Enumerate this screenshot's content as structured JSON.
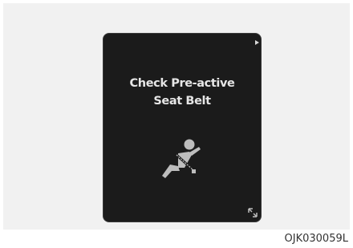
{
  "display": {
    "message_line1": "Check Pre-active",
    "message_line2": "Seat Belt",
    "text_color": "#e6e6e6",
    "background_color": "#1b1b1b",
    "icons": [
      "seatbelt-warning-icon",
      "expand-icon",
      "next-page-indicator-icon"
    ]
  },
  "figure": {
    "code": "OJK030059L"
  }
}
